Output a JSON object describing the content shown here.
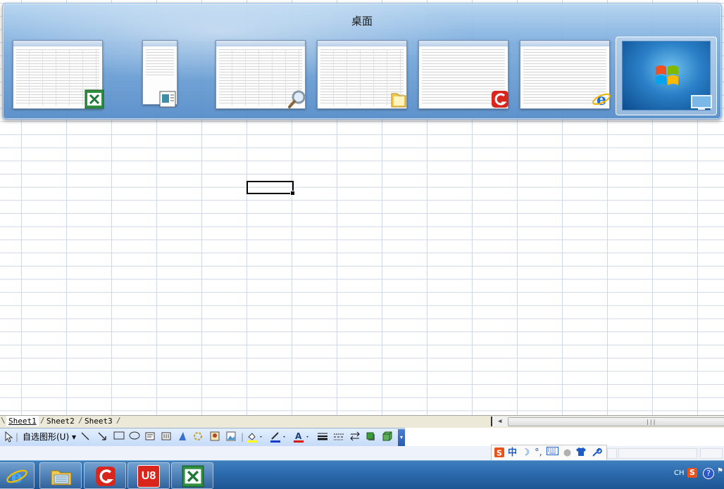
{
  "switcher": {
    "title": "桌面",
    "thumbnails": [
      {
        "name": "excel-window-thumb",
        "app_icon": "excel-icon"
      },
      {
        "name": "dialog-window-thumb",
        "app_icon": "document-icon"
      },
      {
        "name": "search-window-thumb",
        "app_icon": "magnifier-icon"
      },
      {
        "name": "explorer-window-thumb",
        "app_icon": "folder-icon"
      },
      {
        "name": "u8-window-thumb",
        "app_icon": "u8-red-icon"
      },
      {
        "name": "ie-window-thumb",
        "app_icon": "ie-icon"
      },
      {
        "name": "desktop-thumb",
        "app_icon": "windows7-logo"
      }
    ]
  },
  "sheet_tabs": [
    "Sheet1",
    "Sheet2",
    "Sheet3"
  ],
  "drawing_toolbar": {
    "autoshapes_label": "自选图形(U)",
    "items": [
      "select-pointer",
      "autoshapes",
      "line",
      "arrow",
      "rectangle",
      "oval",
      "text-box",
      "vertical-text-box",
      "wordart",
      "diagram",
      "clip-art",
      "picture",
      "fill-color",
      "line-color",
      "font-color",
      "line-style",
      "dash-style",
      "arrow-style",
      "shadow-style",
      "3d-style"
    ]
  },
  "ime_bar": {
    "items": [
      "sogou-s-icon",
      "chinese-mode",
      "half-width-moon",
      "punctuation",
      "soft-keyboard",
      "user",
      "skin",
      "settings-wrench"
    ],
    "mode_text": "中"
  },
  "taskbar": {
    "buttons": [
      "internet-explorer",
      "file-manager",
      "u8-client",
      "u8",
      "excel"
    ],
    "u8_label": "U8",
    "lang": "CH",
    "tray_ime": "S",
    "help": "?"
  },
  "colors": {
    "switcher_blue": "#5a94d0",
    "taskbar_blue": "#2c6aad",
    "grid_line": "#d0d7e5",
    "excel_green": "#1d7a3a",
    "u8_red": "#d8261d"
  }
}
